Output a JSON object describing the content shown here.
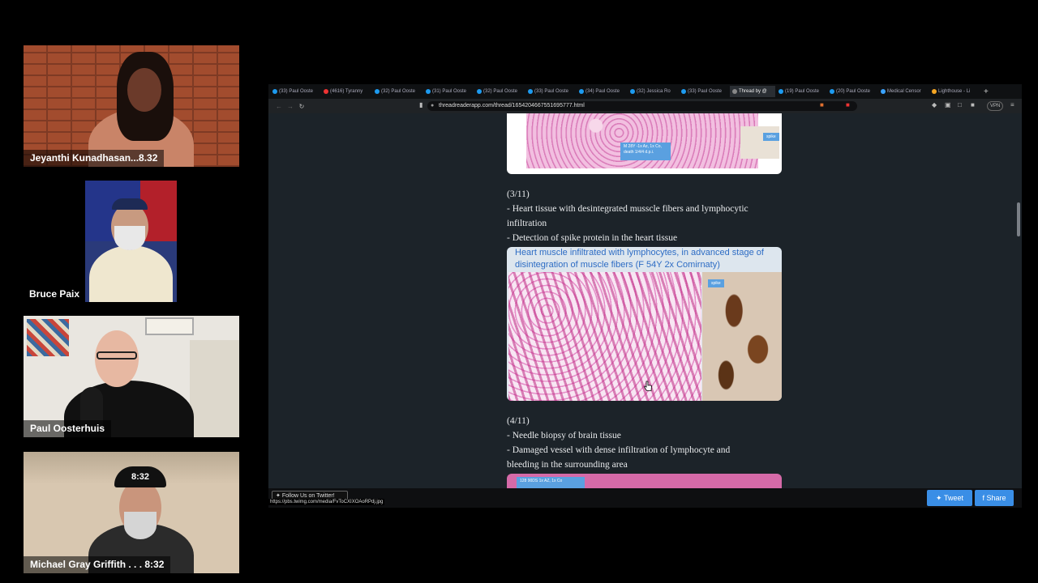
{
  "participants": [
    {
      "name": "Jeyanthi Kunadhasan...8.32"
    },
    {
      "name": "Bruce Paix"
    },
    {
      "name": "Paul Oosterhuis"
    },
    {
      "name": "Michael Gray Griffith . . . 8:32"
    }
  ],
  "cap_text": "8:32",
  "browser": {
    "tabs": [
      {
        "label": "(33) Paul Ooste",
        "icon_color": "#1d9bf0"
      },
      {
        "label": "(4616) Tyranny",
        "icon_color": "#e33"
      },
      {
        "label": "(32) Paul Ooste",
        "icon_color": "#1d9bf0"
      },
      {
        "label": "(31) Paul Ooste",
        "icon_color": "#1d9bf0"
      },
      {
        "label": "(32) Paul Ooste",
        "icon_color": "#1d9bf0"
      },
      {
        "label": "(33) Paul Ooste",
        "icon_color": "#1d9bf0"
      },
      {
        "label": "(34) Paul Ooste",
        "icon_color": "#1d9bf0"
      },
      {
        "label": "(32) Jessica Ro",
        "icon_color": "#1d9bf0"
      },
      {
        "label": "(33) Paul Ooste",
        "icon_color": "#1d9bf0"
      },
      {
        "label": "Thread by @",
        "icon_color": "#888",
        "active": true
      },
      {
        "label": "(19) Paul Ooste",
        "icon_color": "#1d9bf0"
      },
      {
        "label": "(20) Paul Ooste",
        "icon_color": "#1d9bf0"
      },
      {
        "label": "Medical Censor",
        "icon_color": "#3aa3ff"
      },
      {
        "label": "Lighthouse - Li",
        "icon_color": "#f5a623"
      }
    ],
    "url": "threadreaderapp.com/thread/1654204667551695777.html",
    "vpn_label": "VPN"
  },
  "thread": {
    "figure1_tag": "spike",
    "figure1_caption": "M 28Y -1x Az, 1x Co, death 1/4/4 d.p.i.",
    "post3": {
      "index": "(3/11)",
      "lines": [
        "- Heart tissue with desintegrated musscle fibers and lymphocytic infiltration",
        "- Detection of spike protein in the heart tissue"
      ],
      "figure_caption": "Heart muscle infiltrated with lymphocytes, in advanced stage of disintegration of muscle fibers  (F 54Y 2x Comirnaty)",
      "figure_tag": "spike"
    },
    "post4": {
      "index": "(4/11)",
      "lines": [
        "- Needle biopsy of brain tissue",
        "- Damaged vessel with dense infiltration of lymphocyte and bleeding in the surrounding area"
      ],
      "figure_caption": "128 90DS 1x AZ, 1x Co"
    }
  },
  "footer": {
    "follow_label": "Follow Us on Twitter!",
    "status_url": "https://pbs.twimg.com/media/FvToCXIXOAoRPdj.jpg",
    "tweet_label": "Tweet",
    "share_label": "Share"
  }
}
